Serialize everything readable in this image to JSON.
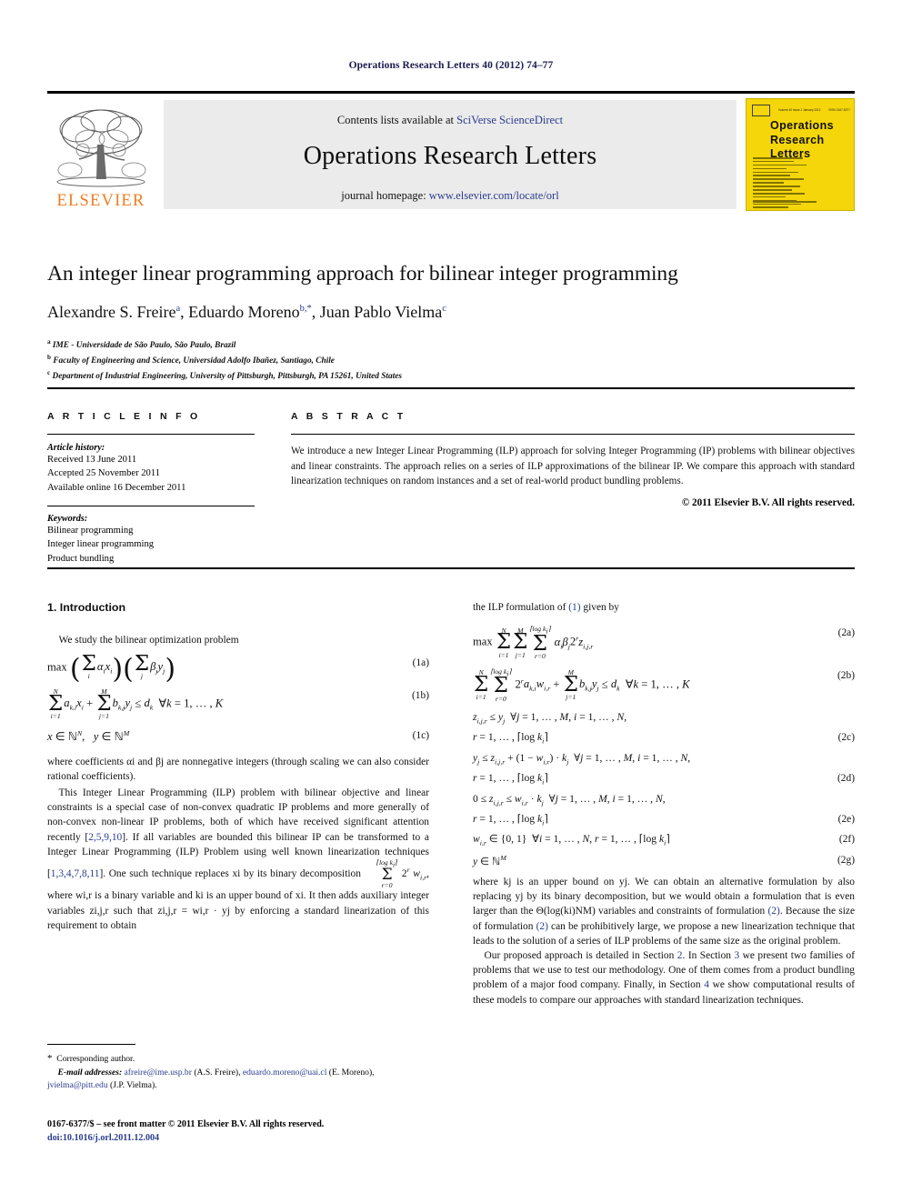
{
  "running_head": "Operations Research Letters 40 (2012) 74–77",
  "masthead": {
    "publisher_name": "ELSEVIER",
    "contents_prefix": "Contents lists available at ",
    "contents_link": "SciVerse ScienceDirect",
    "journal_title": "Operations Research Letters",
    "homepage_prefix": "journal homepage: ",
    "homepage_link": "www.elsevier.com/locate/orl",
    "cover": {
      "title_line1": "Operations",
      "title_line2": "Research",
      "title_line3": "Letters",
      "issn_text": "ISSN 0167-6377",
      "volume_text": "Volume 40 Issue 1  January 2012"
    }
  },
  "title": "An integer linear programming approach for bilinear integer programming",
  "authors": [
    {
      "name": "Alexandre S. Freire",
      "marks": "a"
    },
    {
      "name": "Eduardo Moreno",
      "marks": "b,*"
    },
    {
      "name": "Juan Pablo Vielma",
      "marks": "c"
    }
  ],
  "affiliations": [
    {
      "mark": "a",
      "text": "IME - Universidade de São Paulo, São Paulo, Brazil"
    },
    {
      "mark": "b",
      "text": "Faculty of Engineering and Science, Universidad Adolfo Ibañez, Santiago, Chile"
    },
    {
      "mark": "c",
      "text": "Department of Industrial Engineering, University of Pittsburgh, Pittsburgh, PA 15261, United States"
    }
  ],
  "article_info": {
    "heading": "A R T I C L E    I N F O",
    "history_label": "Article history:",
    "history": [
      "Received 13 June 2011",
      "Accepted 25 November 2011",
      "Available online 16 December 2011"
    ],
    "keywords_label": "Keywords:",
    "keywords": [
      "Bilinear programming",
      "Integer linear programming",
      "Product bundling"
    ]
  },
  "abstract": {
    "heading": "A B S T R A C T",
    "text": "We introduce a new Integer Linear Programming (ILP) approach for solving Integer Programming (IP) problems with bilinear objectives and linear constraints. The approach relies on a series of ILP approximations of the bilinear IP. We compare this approach with standard linearization techniques on random instances and a set of real-world product bundling problems.",
    "copyright": "© 2011 Elsevier B.V. All rights reserved."
  },
  "left_column": {
    "section_heading": "1. Introduction",
    "para_intro": "We study the bilinear optimization problem",
    "eq_tags": {
      "e1a": "(1a)",
      "e1b": "(1b)",
      "e1c": "(1c)"
    },
    "para_where": "where coefficients αi and βj are nonnegative integers (through scaling we can also consider rational coefficients).",
    "para_ilp_1": "This Integer Linear Programming (ILP) problem with bilinear objective and linear constraints is a special case of non-convex quadratic IP problems and more generally of non-convex non-linear IP problems, both of which have received significant attention recently [",
    "refs_1": "2,5,9,10",
    "para_ilp_2": "]. If all variables are bounded this bilinear IP can be transformed to a Integer Linear Programming (ILP) Problem using well known linearization techniques [",
    "refs_2": "1,3,4,7,8,11",
    "para_ilp_3": "]. One such technique replaces xi by its binary decomposition",
    "para_ilp_4": ", where wi,r is a binary variable and ki is an upper bound of xi. It then adds auxiliary integer variables zi,j,r such that zi,j,r = wi,r · yj by enforcing a standard linearization of this requirement to obtain"
  },
  "right_column": {
    "lead_in_a": "the ILP formulation of ",
    "lead_in_ref": "(1)",
    "lead_in_b": " given by",
    "eq_tags": {
      "e2a": "(2a)",
      "e2b": "(2b)",
      "e2c": "(2c)",
      "e2d": "(2d)",
      "e2e": "(2e)",
      "e2f": "(2f)",
      "e2g": "(2g)"
    },
    "para_where_1": "where kj is an upper bound on yj. We can obtain an alternative formulation by also replacing yj by its binary decomposition, but we would obtain a formulation that is even larger than the Θ(log(ki)NM) variables and constraints of formulation ",
    "ref_2a": "(2)",
    "para_where_2": ". Because the size of formulation ",
    "ref_2b": "(2)",
    "para_where_3": " can be prohibitively large, we propose a new linearization technique that leads to the solution of a series of ILP problems of the same size as the original problem.",
    "para_outline_1": "Our proposed approach is detailed in Section ",
    "ref_s2": "2",
    "para_outline_2": ". In Section ",
    "ref_s3": "3",
    "para_outline_3": " we present two families of problems that we use to test our methodology. One of them comes from a product bundling problem of a major food company. Finally, in Section ",
    "ref_s4": "4",
    "para_outline_4": " we show computational results of these models to compare our approaches with standard linearization techniques."
  },
  "footnote": {
    "star": "*",
    "corresponding": "Corresponding author.",
    "email_label": "E-mail addresses:",
    "emails": [
      {
        "address": "afreire@ime.usp.br",
        "owner": " (A.S. Freire), "
      },
      {
        "address": "eduardo.moreno@uai.cl",
        "owner": " (E. Moreno), "
      },
      {
        "address": "jvielma@pitt.edu",
        "owner": " (J.P. Vielma)."
      }
    ]
  },
  "front_matter": {
    "line1": "0167-6377/$ – see front matter © 2011 Elsevier B.V. All rights reserved.",
    "doi": "doi:10.1016/j.orl.2011.12.004"
  },
  "colors": {
    "link": "#2b3c8e",
    "elsevier_orange": "#ef7d20",
    "cover_yellow": "#f5d60a",
    "banner_gray": "#ebebeb",
    "runhead": "#1a1a4e"
  }
}
